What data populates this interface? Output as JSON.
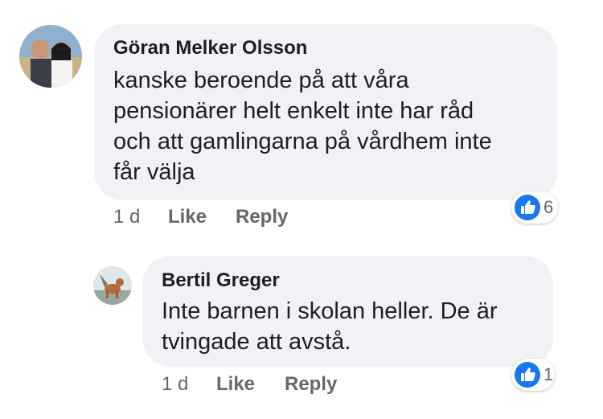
{
  "comments": [
    {
      "author": "Göran Melker Olsson",
      "text": "kanske beroende på att våra\npensionärer helt enkelt inte har råd\noch att gamlingarna på vårdhem inte\nfår välja",
      "time": "1 d",
      "like_label": "Like",
      "reply_label": "Reply",
      "like_count": "6"
    },
    {
      "author": "Bertil Greger",
      "text": "Inte barnen i skolan heller. De är\ntvingade att avstå.",
      "time": "1 d",
      "like_label": "Like",
      "reply_label": "Reply",
      "like_count": "1"
    }
  ],
  "colors": {
    "bubble": "#f0f2f5",
    "like_blue": "#1877f2",
    "meta_gray": "#65676b"
  },
  "icons": {
    "reaction": "thumbs-up-icon"
  }
}
